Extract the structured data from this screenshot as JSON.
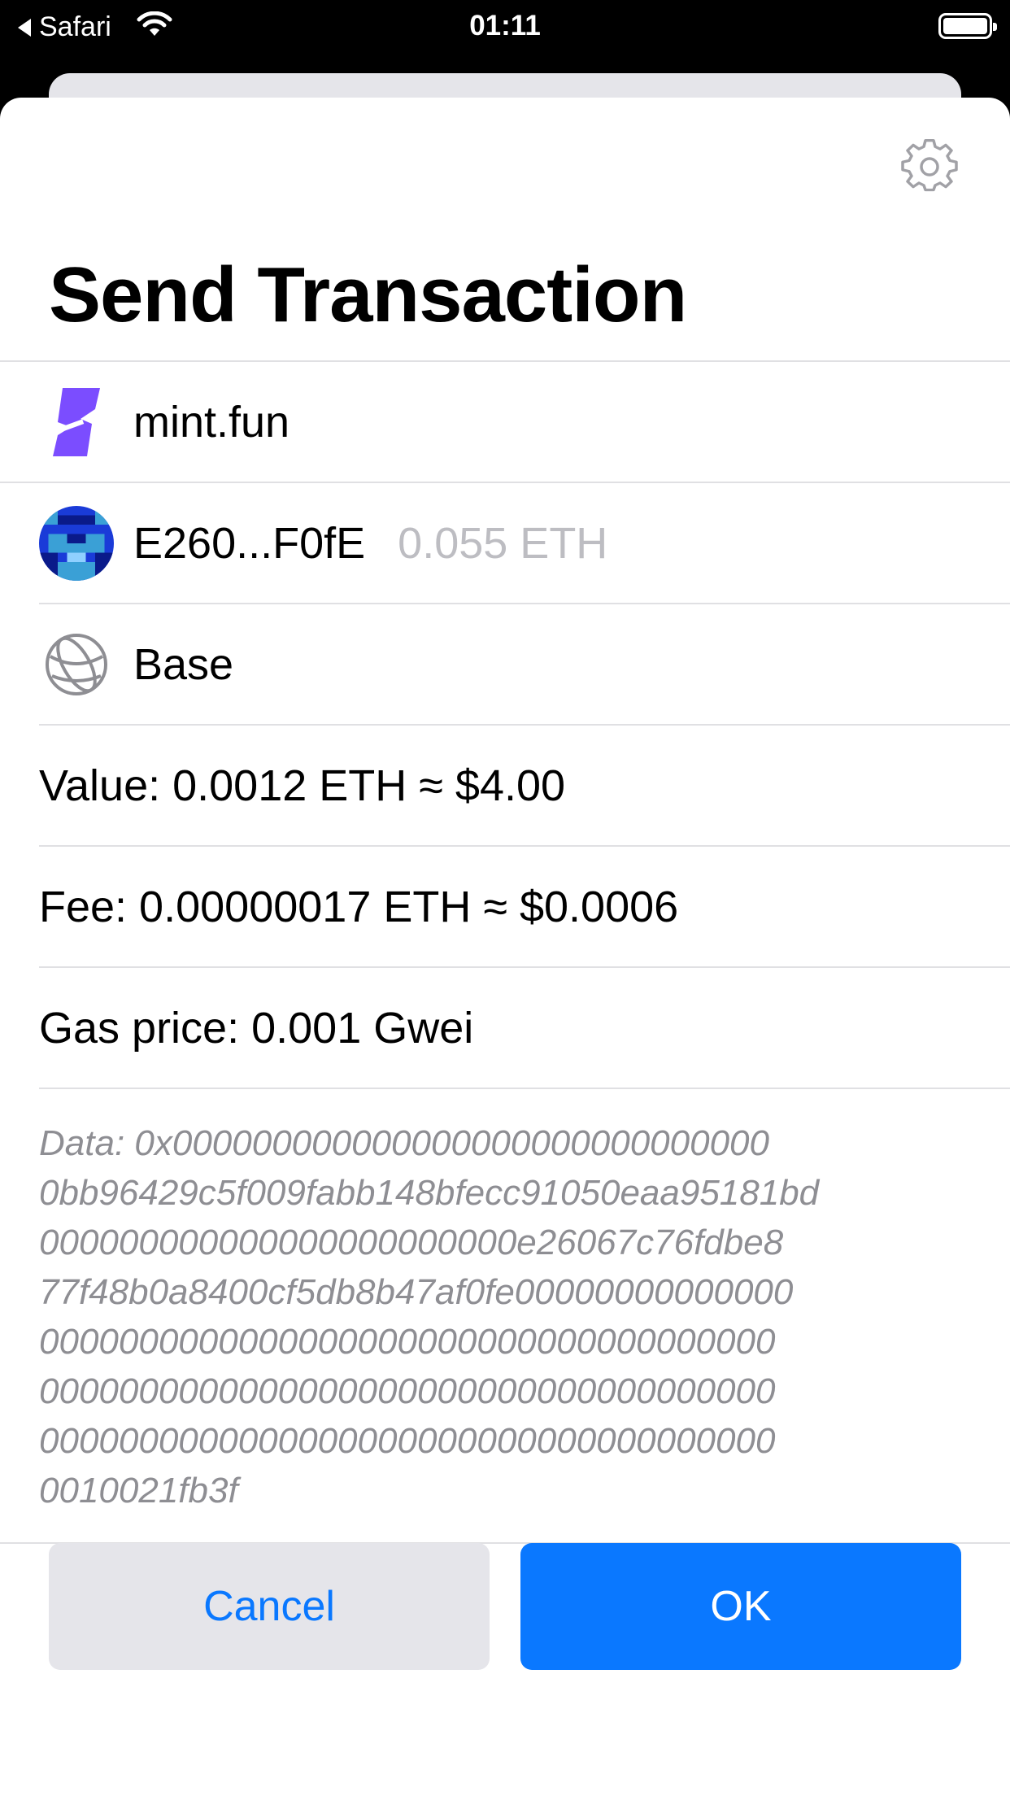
{
  "status_bar": {
    "back_app": "Safari",
    "time": "01:11"
  },
  "sheet": {
    "title": "Send Transaction",
    "rows": {
      "dapp": {
        "icon": "mint-fun-logo",
        "label": "mint.fun",
        "color": "#7b4dff"
      },
      "account": {
        "icon": "pixel-avatar",
        "address": "E260...F0fE",
        "balance": "0.055 ETH"
      },
      "network": {
        "icon": "globe-icon",
        "label": "Base"
      },
      "value": "Value: 0.0012 ETH ≈ $4.00",
      "fee": "Fee: 0.00000017 ETH ≈ $0.0006",
      "gas_price": "Gas price: 0.001 Gwei"
    },
    "data_lines": [
      "Data: 0x000000000000000000000000000000",
      "0bb96429c5f009fabb148bfecc91050eaa95181bd",
      "000000000000000000000000e26067c76fdbe8",
      "77f48b0a8400cf5db8b47af0fe00000000000000",
      "0000000000000000000000000000000000000",
      "0000000000000000000000000000000000000",
      "0000000000000000000000000000000000000",
      "0010021fb3f"
    ]
  },
  "buttons": {
    "cancel": "Cancel",
    "ok": "OK"
  },
  "colors": {
    "accent": "#0a78ff",
    "secondary_button": "#e5e5ea",
    "muted_text": "#8e8e93"
  }
}
